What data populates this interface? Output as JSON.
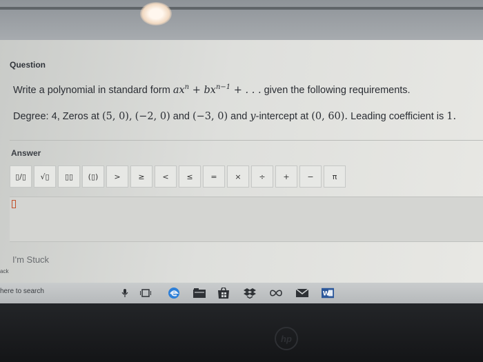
{
  "question": {
    "label": "Question",
    "line1": {
      "prefix": "Write a polynomial in standard form",
      "suffix": "given the following requirements."
    },
    "line2": {
      "degree_label": "Degree:",
      "degree_value": "4,",
      "zeros_label": "Zeros at",
      "zero1": "(5, 0),",
      "zero2": "(−2, 0)",
      "and1": "and",
      "zero3": "(−3, 0)",
      "and2": "and",
      "y_var": "y",
      "intercept_label": "-intercept at",
      "intercept": "(0, 60).",
      "leading_label": "Leading coefficient is",
      "leading_value": "1."
    }
  },
  "answer": {
    "label": "Answer",
    "toolbar": [
      {
        "name": "fraction-button",
        "glyph": "▯/▯"
      },
      {
        "name": "sqrt-button",
        "glyph": "√▯"
      },
      {
        "name": "exponent-button",
        "glyph": "▯▯"
      },
      {
        "name": "parentheses-button",
        "glyph": "(▯)"
      },
      {
        "name": "greater-than-button",
        "glyph": ">"
      },
      {
        "name": "greater-equal-button",
        "glyph": "≥"
      },
      {
        "name": "less-than-button",
        "glyph": "<"
      },
      {
        "name": "less-equal-button",
        "glyph": "≤"
      },
      {
        "name": "equals-button",
        "glyph": "="
      },
      {
        "name": "multiply-button",
        "glyph": "×"
      },
      {
        "name": "divide-button",
        "glyph": "÷"
      },
      {
        "name": "plus-button",
        "glyph": "+"
      },
      {
        "name": "minus-button",
        "glyph": "−"
      },
      {
        "name": "pi-button",
        "glyph": "π"
      }
    ]
  },
  "stuck_link": "I'm Stuck",
  "back_label": "ack",
  "taskbar": {
    "search_text": "here to search",
    "icons": [
      "microphone-icon",
      "task-view-icon",
      "edge-icon",
      "file-explorer-icon",
      "store-icon",
      "dropbox-icon",
      "infinity-icon",
      "mail-icon",
      "word-icon"
    ]
  },
  "brand": "hp",
  "colors": {
    "cursor_outline": "#c2502a",
    "edge_blue": "#2d7fd8",
    "word_blue": "#2b579a"
  }
}
